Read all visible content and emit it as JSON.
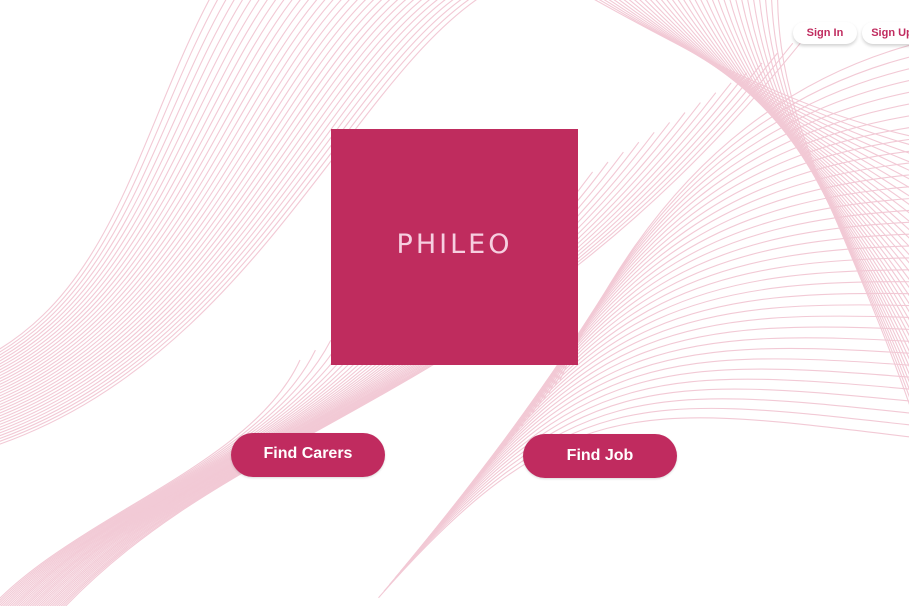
{
  "header": {
    "sign_in_label": "Sign In",
    "sign_up_label": "Sign Up"
  },
  "logo": {
    "text": "PHILEO"
  },
  "actions": {
    "find_carers_label": "Find Carers",
    "find_job_label": "Find Job"
  },
  "colors": {
    "brand": "#c02b5f",
    "background": "#ffffff",
    "wave_lines": "#f2c9d5"
  }
}
